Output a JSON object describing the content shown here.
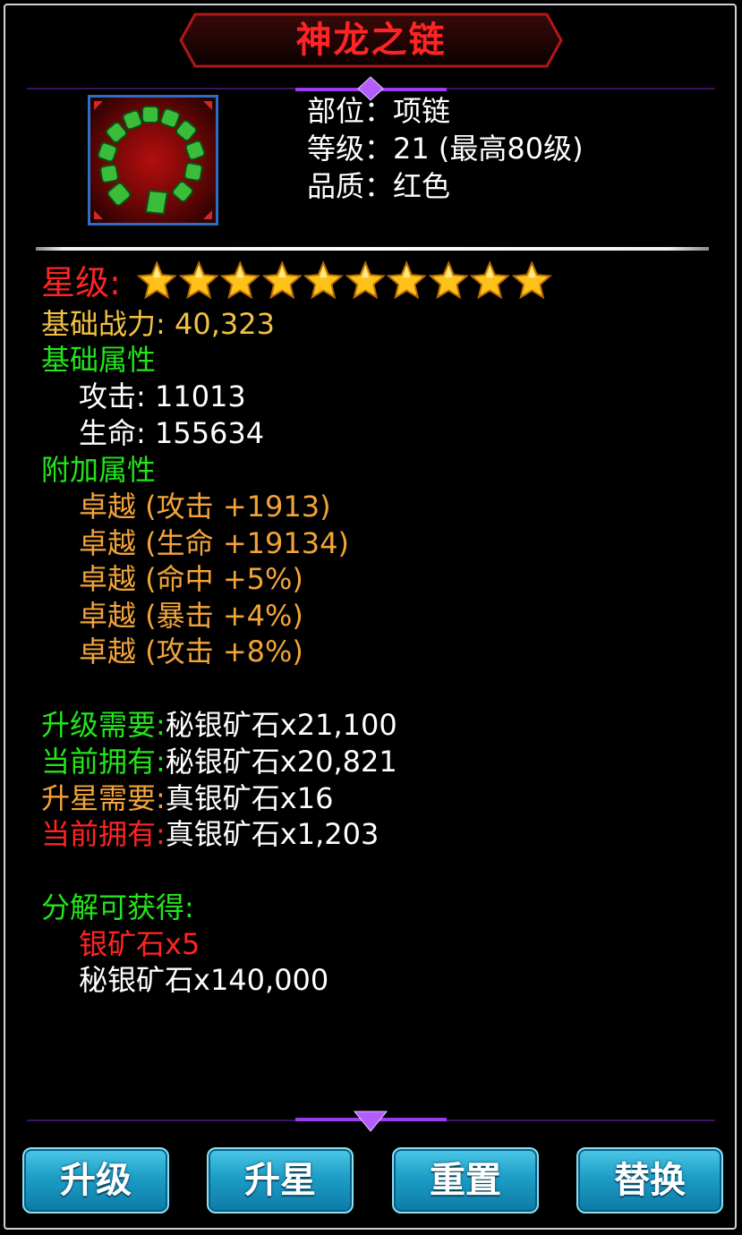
{
  "item": {
    "name": "神龙之链",
    "slot_label": "部位",
    "slot_value": "项链",
    "level_label": "等级",
    "level_value": "21",
    "level_max": "(最高80级)",
    "quality_label": "品质",
    "quality_value": "红色"
  },
  "stars": {
    "label": "星级:",
    "count": 10,
    "max": 10
  },
  "power": {
    "label": "基础战力:",
    "value": "40,323"
  },
  "base_attributes": {
    "title": "基础属性",
    "items": [
      {
        "label": "攻击:",
        "value": "11013"
      },
      {
        "label": "生命:",
        "value": "155634"
      }
    ]
  },
  "extra_attributes": {
    "title": "附加属性",
    "items": [
      "卓越 (攻击 +1913)",
      "卓越 (生命 +19134)",
      "卓越 (命中 +5%)",
      "卓越 (暴击 +4%)",
      "卓越 (攻击 +8%)"
    ]
  },
  "requirements": [
    {
      "label": "升级需要:",
      "value": "秘银矿石x21,100",
      "label_color": "#22e61a"
    },
    {
      "label": "当前拥有:",
      "value": "秘银矿石x20,821",
      "label_color": "#22e61a"
    },
    {
      "label": "升星需要:",
      "value": "真银矿石x16",
      "label_color": "#f2a43a"
    },
    {
      "label": "当前拥有:",
      "value": "真银矿石x1,203",
      "label_color": "#ff2424"
    }
  ],
  "decompose": {
    "title": "分解可获得:",
    "items": [
      {
        "text": "银矿石x5",
        "color": "#ff2424"
      },
      {
        "text": "秘银矿石x140,000",
        "color": "#ffffff"
      }
    ]
  },
  "buttons": {
    "upgrade": "升级",
    "star_up": "升星",
    "reset": "重置",
    "replace": "替换"
  },
  "colors": {
    "title_red": "#ff2424",
    "green": "#22e61a",
    "orange": "#f2a43a",
    "button_blue": "#1d9ec6",
    "accent_purple": "#9a3df0"
  }
}
